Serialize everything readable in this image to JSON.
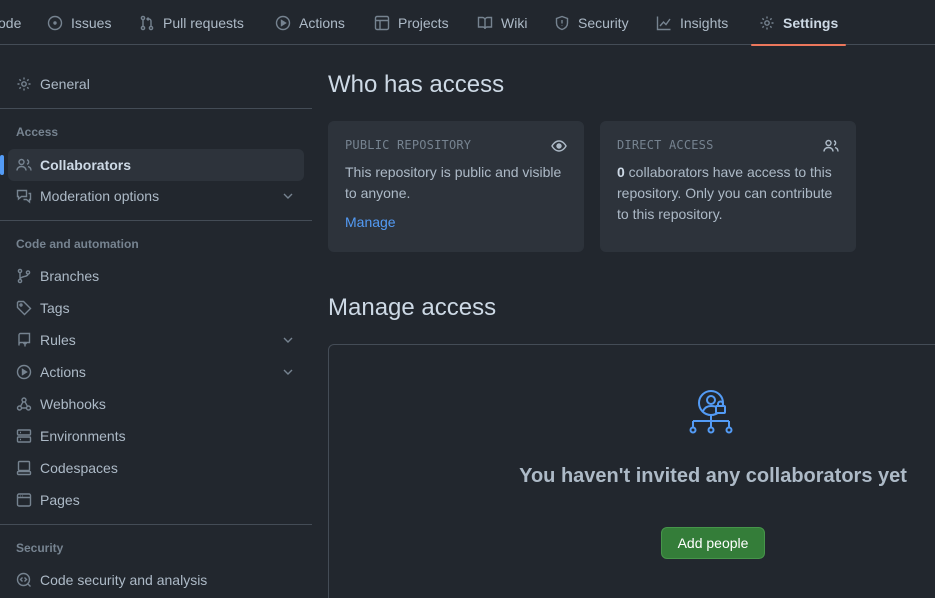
{
  "topnav": {
    "items": [
      {
        "label": "ode",
        "icon": "code-icon"
      },
      {
        "label": "Issues",
        "icon": "issue-icon"
      },
      {
        "label": "Pull requests",
        "icon": "pull-request-icon"
      },
      {
        "label": "Actions",
        "icon": "play-icon"
      },
      {
        "label": "Projects",
        "icon": "table-icon"
      },
      {
        "label": "Wiki",
        "icon": "book-icon"
      },
      {
        "label": "Security",
        "icon": "shield-icon"
      },
      {
        "label": "Insights",
        "icon": "graph-icon"
      },
      {
        "label": "Settings",
        "icon": "gear-icon",
        "active": true
      }
    ]
  },
  "sidebar": {
    "general": "General",
    "access_heading": "Access",
    "collaborators": "Collaborators",
    "moderation": "Moderation options",
    "code_heading": "Code and automation",
    "branches": "Branches",
    "tags": "Tags",
    "rules": "Rules",
    "actions": "Actions",
    "webhooks": "Webhooks",
    "environments": "Environments",
    "codespaces": "Codespaces",
    "pages": "Pages",
    "security_heading": "Security",
    "code_security": "Code security and analysis"
  },
  "main": {
    "who_title": "Who has access",
    "public_card": {
      "label": "PUBLIC REPOSITORY",
      "text": "This repository is public and visible to anyone.",
      "link": "Manage"
    },
    "direct_card": {
      "label": "DIRECT ACCESS",
      "count": "0",
      "text": " collaborators have access to this repository. Only you can contribute to this repository."
    },
    "manage_title": "Manage access",
    "empty_title": "You haven't invited any collaborators yet",
    "add_button": "Add people"
  },
  "colors": {
    "accent_underline": "#ec775c",
    "link": "#539bf5",
    "button": "#347d39",
    "background": "#22272e"
  }
}
